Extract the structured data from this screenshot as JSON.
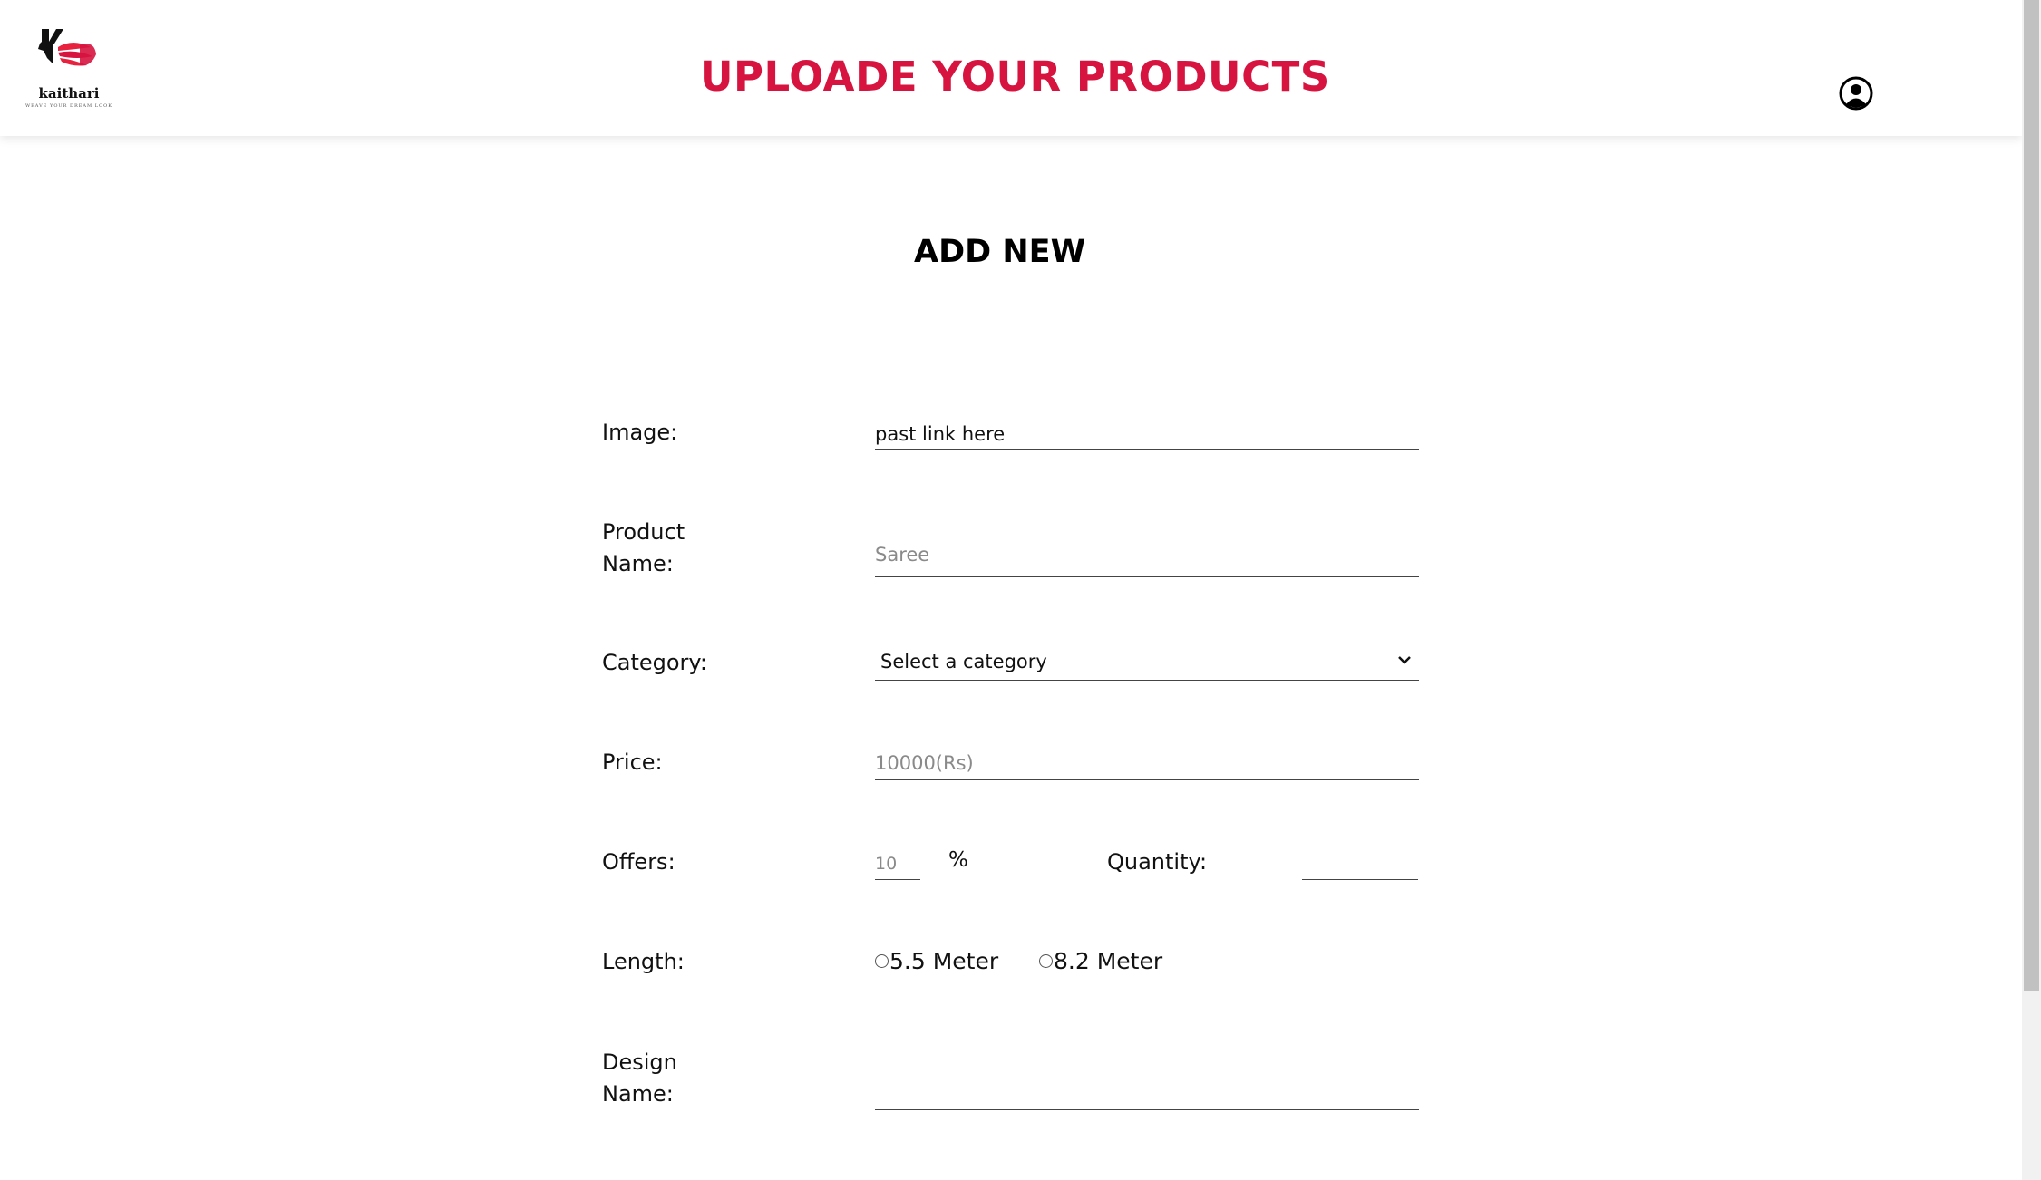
{
  "header": {
    "brand_name": "kaithari",
    "brand_tagline": "WEAVE YOUR DREAM LOOK",
    "title": "UPLOADE YOUR PRODUCTS",
    "accent_color": "#d6143f",
    "profile_icon": "user-circle-icon"
  },
  "form": {
    "heading": "ADD NEW",
    "image": {
      "label": "Image:",
      "value": "past link here"
    },
    "product_name": {
      "label_line1": "Product",
      "label_line2": "Name:",
      "placeholder": "Saree",
      "value": ""
    },
    "category": {
      "label": "Category:",
      "selected": "Select a category",
      "icon": "chevron-down-icon"
    },
    "price": {
      "label": "Price:",
      "placeholder": "10000(Rs)",
      "value": ""
    },
    "offers": {
      "label": "Offers:",
      "placeholder": "10",
      "value": "",
      "unit": "%"
    },
    "quantity": {
      "label": "Quantity:",
      "value": ""
    },
    "length": {
      "label": "Length:",
      "options": [
        "5.5 Meter",
        "8.2 Meter"
      ]
    },
    "design_name": {
      "label_line1": "Design",
      "label_line2": "Name:",
      "value": ""
    }
  }
}
